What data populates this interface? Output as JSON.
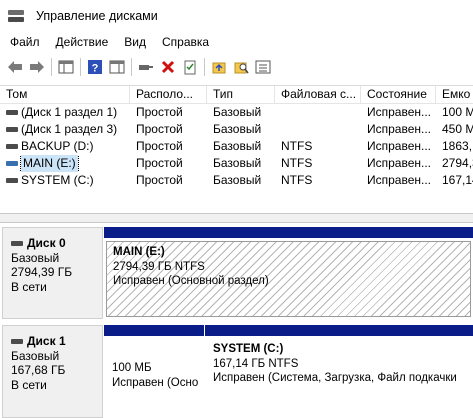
{
  "window": {
    "title": "Управление дисками"
  },
  "menu": [
    "Файл",
    "Действие",
    "Вид",
    "Справка"
  ],
  "toolbar": {
    "icons": [
      "back-arrow-icon",
      "forward-arrow-icon",
      "console-tree-icon",
      "help-icon",
      "details-pane-icon",
      "connect-drive-icon",
      "delete-icon",
      "properties-icon",
      "folder-up-icon",
      "search-folder-icon",
      "list-view-icon"
    ]
  },
  "volume_list": {
    "columns": [
      "Том",
      "Располо...",
      "Тип",
      "Файловая с...",
      "Состояние",
      "Емко"
    ],
    "rows": [
      {
        "volume": "(Диск 1 раздел 1)",
        "layout": "Простой",
        "type": "Базовый",
        "fs": "",
        "status": "Исправен...",
        "capacity": "100 M"
      },
      {
        "volume": "(Диск 1 раздел 3)",
        "layout": "Простой",
        "type": "Базовый",
        "fs": "",
        "status": "Исправен...",
        "capacity": "450 M"
      },
      {
        "volume": "BACKUP (D:)",
        "layout": "Простой",
        "type": "Базовый",
        "fs": "NTFS",
        "status": "Исправен...",
        "capacity": "1863,"
      },
      {
        "volume": "MAIN (E:)",
        "layout": "Простой",
        "type": "Базовый",
        "fs": "NTFS",
        "status": "Исправен...",
        "capacity": "2794,3"
      },
      {
        "volume": "SYSTEM (C:)",
        "layout": "Простой",
        "type": "Базовый",
        "fs": "NTFS",
        "status": "Исправен...",
        "capacity": "167,14"
      }
    ],
    "selected_row": 3
  },
  "disks": [
    {
      "name": "Диск 0",
      "type": "Базовый",
      "size": "2794,39 ГБ",
      "state": "В сети",
      "partitions": [
        {
          "label": "MAIN  (E:)",
          "size": "2794,39 ГБ NTFS",
          "status": "Исправен (Основной раздел)"
        }
      ]
    },
    {
      "name": "Диск 1",
      "type": "Базовый",
      "size": "167,68 ГБ",
      "state": "В сети",
      "partitions": [
        {
          "label": "",
          "size": "100 МБ",
          "status": "Исправен (Осно"
        },
        {
          "label": "SYSTEM  (C:)",
          "size": "167,14 ГБ NTFS",
          "status": "Исправен (Система, Загрузка, Файл подкачки"
        }
      ]
    }
  ],
  "colors": {
    "partition_bar": "#0a1c87",
    "selection": "#cce4f7"
  }
}
